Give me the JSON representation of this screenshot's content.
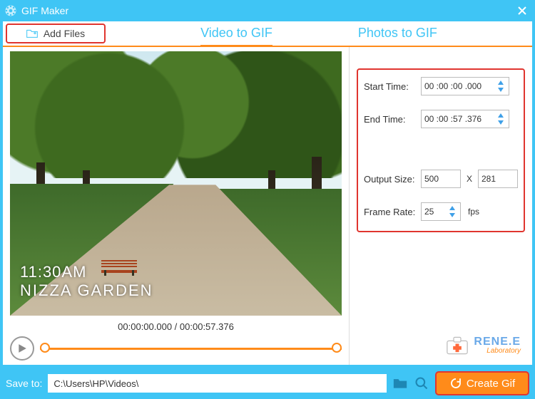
{
  "window": {
    "title": "GIF Maker"
  },
  "toolbar": {
    "add_files": "Add Files"
  },
  "tabs": {
    "video": "Video to GIF",
    "photos": "Photos to GIF",
    "active": "video"
  },
  "preview": {
    "overlay_time": "11:30AM",
    "overlay_place": "NIZZA GARDEN",
    "timecode_current": "00:00:00.000",
    "timecode_total": "00:00:57.376"
  },
  "settings": {
    "start_label": "Start Time:",
    "start_value": "00 :00 :00 .000",
    "end_label": "End Time:",
    "end_value": "00 :00 :57 .376",
    "size_label": "Output Size:",
    "size_w": "500",
    "size_sep": "X",
    "size_h": "281",
    "fps_label": "Frame Rate:",
    "fps_value": "25",
    "fps_unit": "fps"
  },
  "brand": {
    "line1": "RENE.E",
    "line2": "Laboratory"
  },
  "footer": {
    "save_label": "Save to:",
    "path": "C:\\Users\\HP\\Videos\\",
    "create_label": "Create Gif"
  }
}
